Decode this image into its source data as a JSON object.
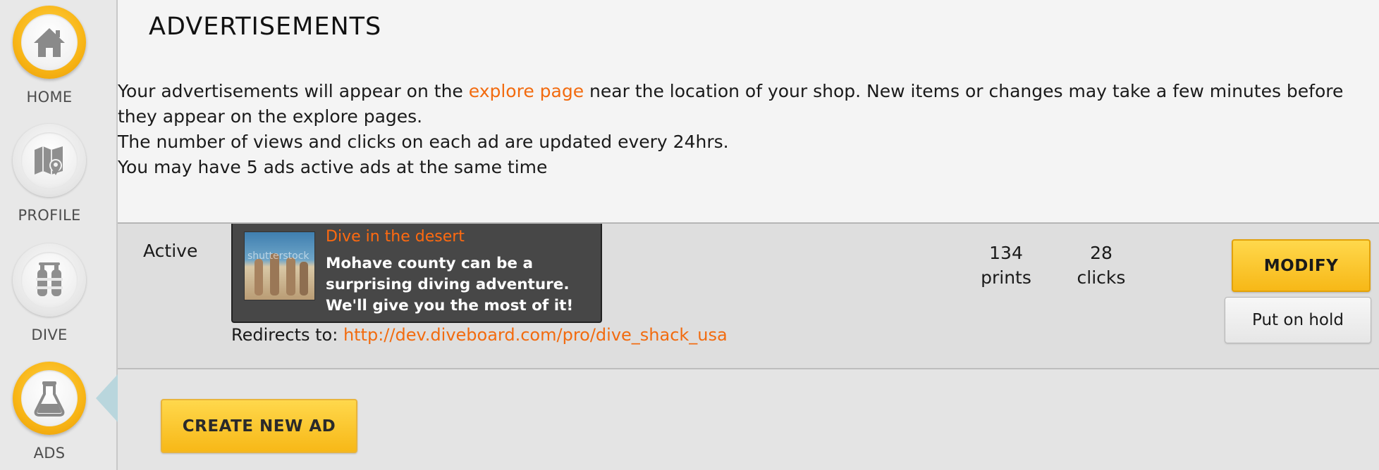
{
  "sidebar": {
    "items": [
      {
        "label": "HOME",
        "icon": "home-icon",
        "state": "highlighted"
      },
      {
        "label": "PROFILE",
        "icon": "map-icon",
        "state": "inactive"
      },
      {
        "label": "DIVE",
        "icon": "scuba-tank-icon",
        "state": "inactive"
      },
      {
        "label": "ADS",
        "icon": "flask-icon",
        "state": "active"
      }
    ]
  },
  "page": {
    "title": "ADVERTISEMENTS",
    "intro": {
      "line1_before": "Your advertisements will appear on the ",
      "line1_link": "explore page",
      "line1_after": " near the location of your shop. New items or changes may take a few minutes before they appear on the explore pages.",
      "line2": "The number of views and clicks on each ad are updated every 24hrs.",
      "line3": "You may have 5 ads active ads at the same time"
    }
  },
  "ads": [
    {
      "status": "Active",
      "title": "Dive in the desert",
      "description": "Mohave county can be a surprising diving adventure. We'll give you the most of it!",
      "redirect_label": "Redirects to:",
      "redirect_url": "http://dev.diveboard.com/pro/dive_shack_usa",
      "prints_value": "134",
      "prints_label": "prints",
      "clicks_value": "28",
      "clicks_label": "clicks",
      "modify_label": "MODIFY",
      "hold_label": "Put on hold",
      "thumb_watermark": "shutterstock"
    }
  ],
  "actions": {
    "create_label": "CREATE NEW AD"
  },
  "colors": {
    "accent": "#f26b0f",
    "button_yellow": "#f7b817",
    "card_bg": "#474747"
  }
}
